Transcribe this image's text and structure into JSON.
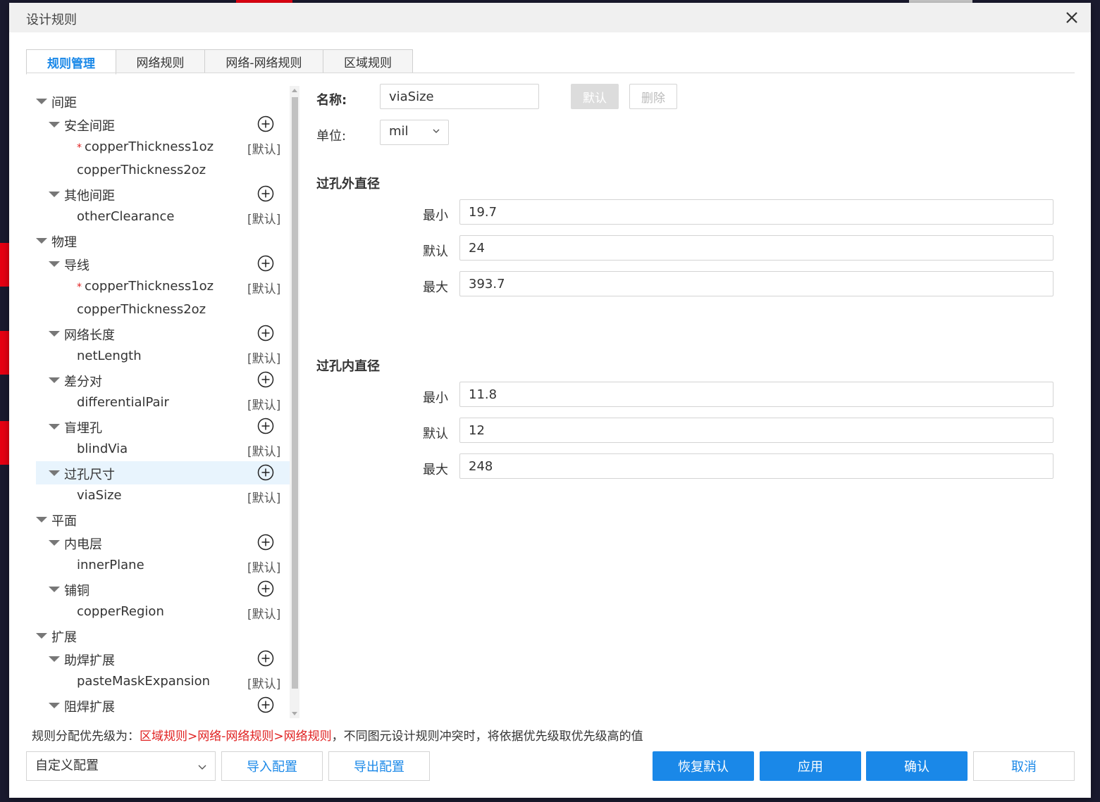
{
  "colors": {
    "accent": "#1a88e8",
    "required": "#e02020",
    "selected_bg": "#e8f4fd"
  },
  "dialog": {
    "title": "设计规则",
    "close_icon": "close-icon"
  },
  "tabs": [
    {
      "label": "规则管理",
      "active": true
    },
    {
      "label": "网络规则",
      "active": false
    },
    {
      "label": "网络-网络规则",
      "active": false
    },
    {
      "label": "区域规则",
      "active": false
    }
  ],
  "tree": [
    {
      "label": "间距",
      "level": 0,
      "expanded": true
    },
    {
      "label": "安全间距",
      "level": 1,
      "expanded": true,
      "add": true
    },
    {
      "label": "copperThickness1oz",
      "level": 2,
      "required": true,
      "tag": "[默认]"
    },
    {
      "label": "copperThickness2oz",
      "level": 2
    },
    {
      "label": "其他间距",
      "level": 1,
      "expanded": true,
      "add": true
    },
    {
      "label": "otherClearance",
      "level": 2,
      "tag": "[默认]"
    },
    {
      "label": "物理",
      "level": 0,
      "expanded": true
    },
    {
      "label": "导线",
      "level": 1,
      "expanded": true,
      "add": true
    },
    {
      "label": "copperThickness1oz",
      "level": 2,
      "required": true,
      "tag": "[默认]"
    },
    {
      "label": "copperThickness2oz",
      "level": 2
    },
    {
      "label": "网络长度",
      "level": 1,
      "expanded": true,
      "add": true
    },
    {
      "label": "netLength",
      "level": 2,
      "tag": "[默认]"
    },
    {
      "label": "差分对",
      "level": 1,
      "expanded": true,
      "add": true
    },
    {
      "label": "differentialPair",
      "level": 2,
      "tag": "[默认]"
    },
    {
      "label": "盲埋孔",
      "level": 1,
      "expanded": true,
      "add": true
    },
    {
      "label": "blindVia",
      "level": 2,
      "tag": "[默认]"
    },
    {
      "label": "过孔尺寸",
      "level": 1,
      "expanded": true,
      "add": true,
      "selected": true
    },
    {
      "label": "viaSize",
      "level": 2,
      "tag": "[默认]"
    },
    {
      "label": "平面",
      "level": 0,
      "expanded": true
    },
    {
      "label": "内电层",
      "level": 1,
      "expanded": true,
      "add": true
    },
    {
      "label": "innerPlane",
      "level": 2,
      "tag": "[默认]"
    },
    {
      "label": "铺铜",
      "level": 1,
      "expanded": true,
      "add": true
    },
    {
      "label": "copperRegion",
      "level": 2,
      "tag": "[默认]"
    },
    {
      "label": "扩展",
      "level": 0,
      "expanded": true
    },
    {
      "label": "助焊扩展",
      "level": 1,
      "expanded": true,
      "add": true
    },
    {
      "label": "pasteMaskExpansion",
      "level": 2,
      "tag": "[默认]"
    },
    {
      "label": "阻焊扩展",
      "level": 1,
      "expanded": true,
      "add": true
    }
  ],
  "form": {
    "name_label": "名称:",
    "name_value": "viaSize",
    "default_button": "默认",
    "delete_button": "删除",
    "unit_label": "单位:",
    "unit_value": "mil"
  },
  "outer": {
    "title": "过孔外直径",
    "min_label": "最小",
    "min_value": "19.7",
    "default_label": "默认",
    "default_value": "24",
    "max_label": "最大",
    "max_value": "393.7"
  },
  "inner": {
    "title": "过孔内直径",
    "min_label": "最小",
    "min_value": "11.8",
    "default_label": "默认",
    "default_value": "12",
    "max_label": "最大",
    "max_value": "248"
  },
  "priority": {
    "prefix": "规则分配优先级为：",
    "order": "区域规则>网络-网络规则>网络规则",
    "suffix": "，不同图元设计规则冲突时，将依据优先级取优先级高的值"
  },
  "footer": {
    "config_value": "自定义配置",
    "import_button": "导入配置",
    "export_button": "导出配置",
    "restore_button": "恢复默认",
    "apply_button": "应用",
    "confirm_button": "确认",
    "cancel_button": "取消"
  }
}
